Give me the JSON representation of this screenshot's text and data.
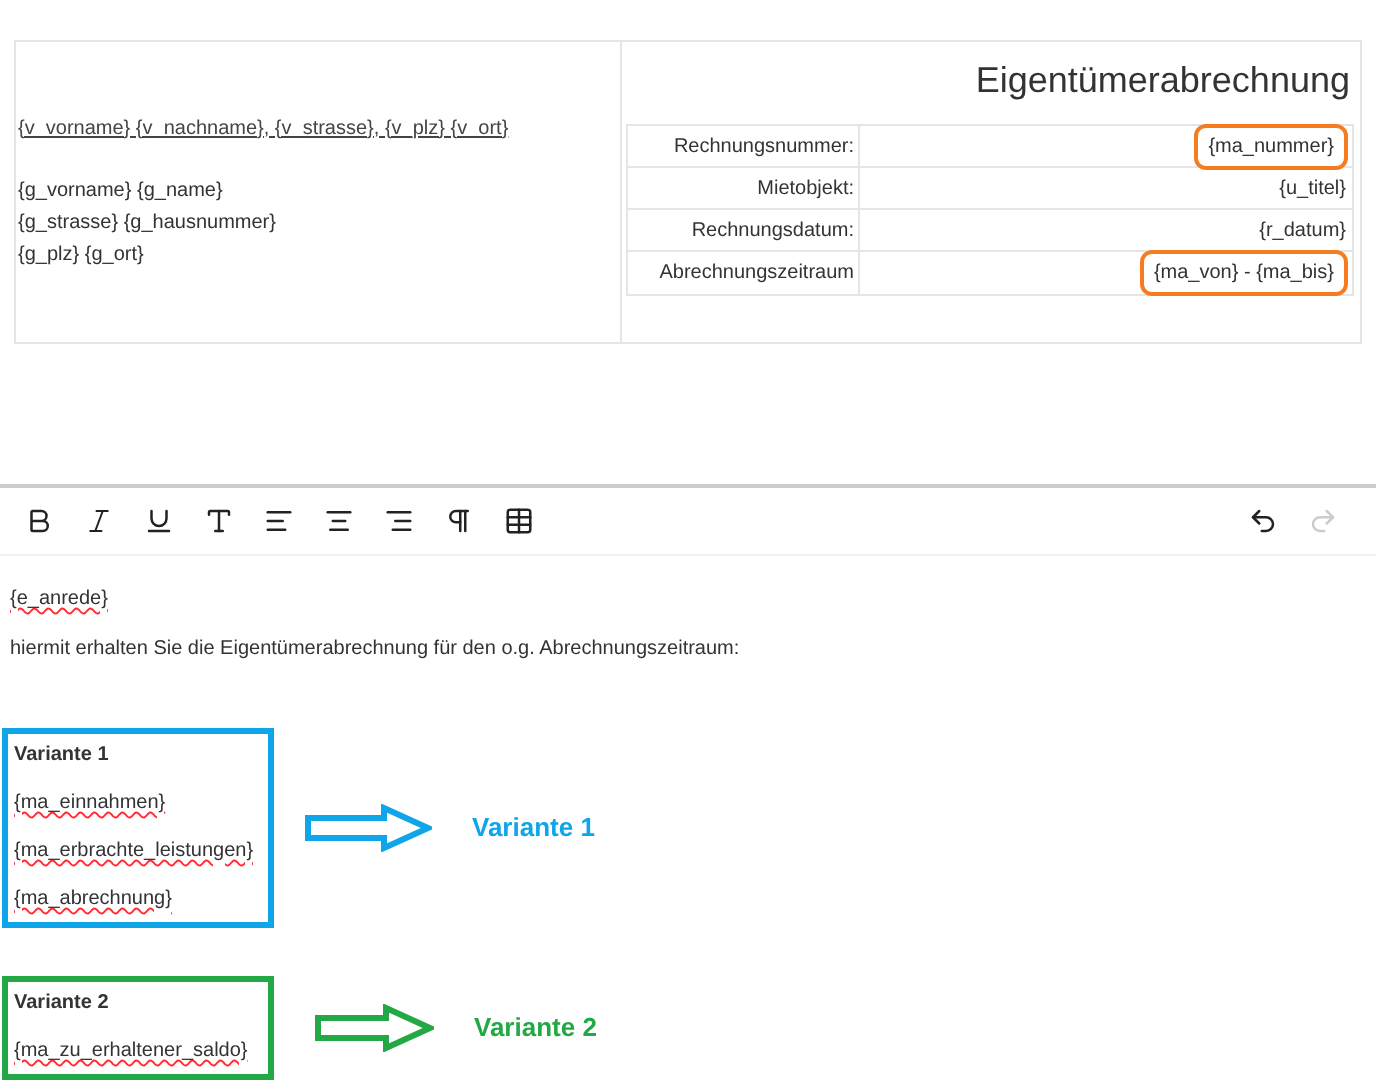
{
  "header": {
    "sender_line": "{v_vorname} {v_nachname}, {v_strasse}, {v_plz} {v_ort}",
    "recipient_lines": [
      "{g_vorname} {g_name}",
      "{g_strasse} {g_hausnummer}",
      "{g_plz} {g_ort}"
    ],
    "title": "Eigentümerabrechnung",
    "info_rows": [
      {
        "label": "Rechnungsnummer:",
        "value": "{ma_nummer}",
        "highlighted": true
      },
      {
        "label": "Mietobjekt:",
        "value": "{u_titel}",
        "highlighted": false
      },
      {
        "label": "Rechnungsdatum:",
        "value": "{r_datum}",
        "highlighted": false
      },
      {
        "label": "Abrechnungszeitraum",
        "value": "{ma_von} - {ma_bis}",
        "highlighted": true
      }
    ]
  },
  "toolbar": [
    {
      "kind": "bold",
      "disabled": false
    },
    {
      "kind": "italic",
      "disabled": false
    },
    {
      "kind": "underline",
      "disabled": false
    },
    {
      "kind": "font-size",
      "disabled": false
    },
    {
      "kind": "align-left",
      "disabled": false
    },
    {
      "kind": "align-center",
      "disabled": false
    },
    {
      "kind": "align-right",
      "disabled": false
    },
    {
      "kind": "paragraph",
      "disabled": false
    },
    {
      "kind": "table",
      "disabled": false
    },
    {
      "kind": "undo",
      "disabled": false
    },
    {
      "kind": "redo",
      "disabled": true
    }
  ],
  "editor": {
    "paragraphs": [
      {
        "text": "{e_anrede}",
        "misspelled": true
      },
      {
        "text": "hiermit erhalten Sie die Eigentümerabrechnung für den o.g. Abrechnungszeitraum:",
        "misspelled": false
      }
    ],
    "variants": [
      {
        "heading": "Variante 1",
        "fields": [
          "{ma_einnahmen}",
          "{ma_erbrachte_leistungen}",
          "{ma_abrechnung}"
        ],
        "callout": "Variante 1",
        "color": "#0ea5e9"
      },
      {
        "heading": "Variante 2",
        "fields": [
          "{ma_zu_erhaltener_saldo}"
        ],
        "callout": "Variante 2",
        "color": "#22a845"
      }
    ]
  }
}
